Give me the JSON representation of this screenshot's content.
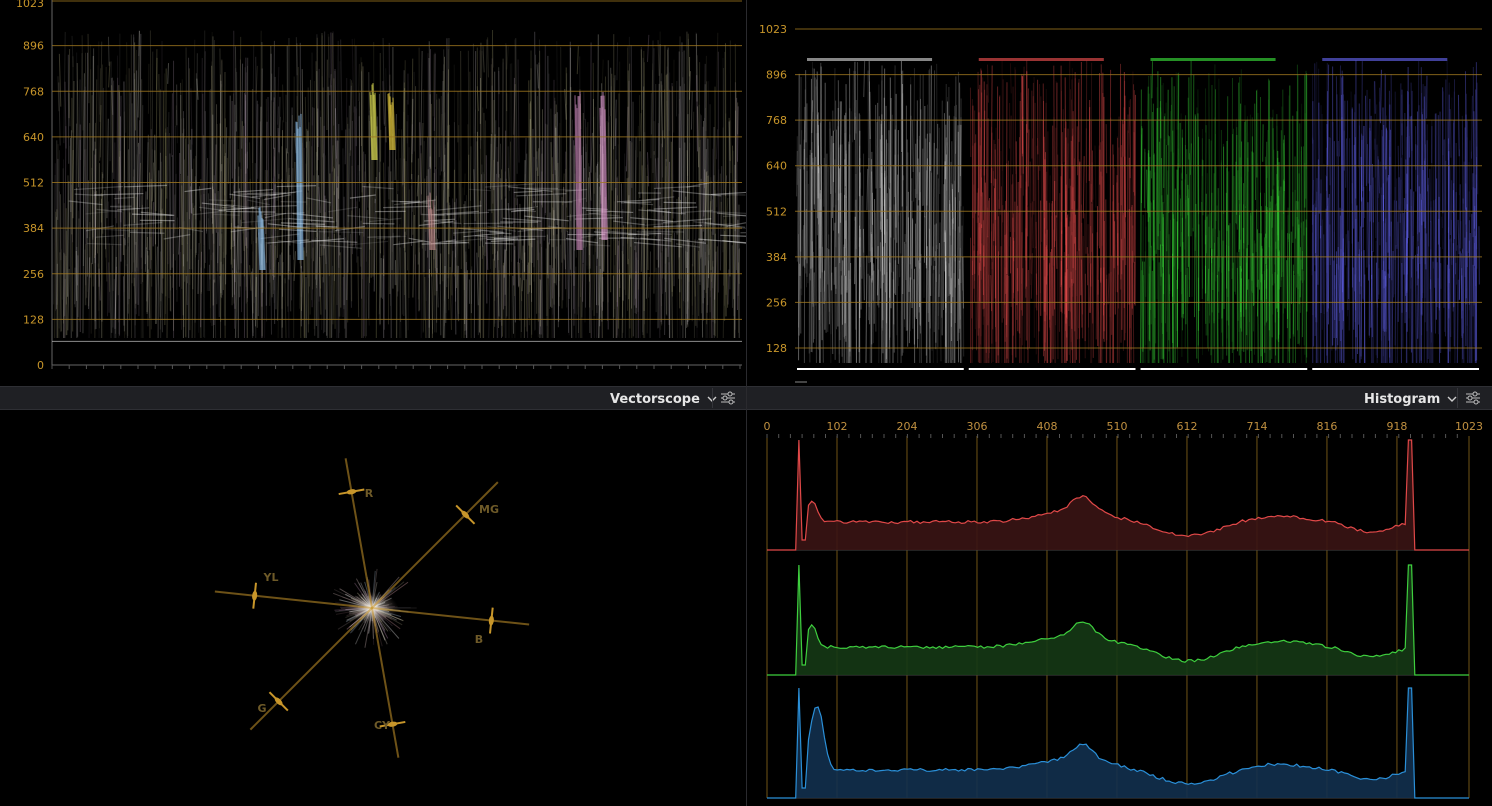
{
  "colors": {
    "accent": "#c8962a",
    "grid": "#a07820",
    "header_bg": "#1f2024",
    "red": "#e04848",
    "green": "#3ecf3e",
    "blue": "#2a8fd8"
  },
  "waveform": {
    "ticks": [
      "1023",
      "896",
      "768",
      "640",
      "512",
      "384",
      "256",
      "128",
      "0"
    ]
  },
  "parade": {
    "ticks": [
      "1023",
      "896",
      "768",
      "640",
      "512",
      "384",
      "256",
      "128"
    ],
    "channels": [
      "luma",
      "red",
      "green",
      "blue"
    ]
  },
  "headers": {
    "left": {
      "scope_label": "Vectorscope",
      "chevron_icon": "chevron-down-icon",
      "settings_icon": "sliders-icon"
    },
    "right": {
      "scope_label": "Histogram",
      "chevron_icon": "chevron-down-icon",
      "settings_icon": "sliders-icon"
    }
  },
  "vectorscope": {
    "targets": [
      "R",
      "MG",
      "B",
      "CY",
      "G",
      "YL"
    ]
  },
  "histogram": {
    "x_ticks": [
      "0",
      "102",
      "204",
      "306",
      "408",
      "510",
      "612",
      "714",
      "816",
      "918",
      "1023"
    ],
    "channels": [
      "red",
      "green",
      "blue"
    ]
  }
}
